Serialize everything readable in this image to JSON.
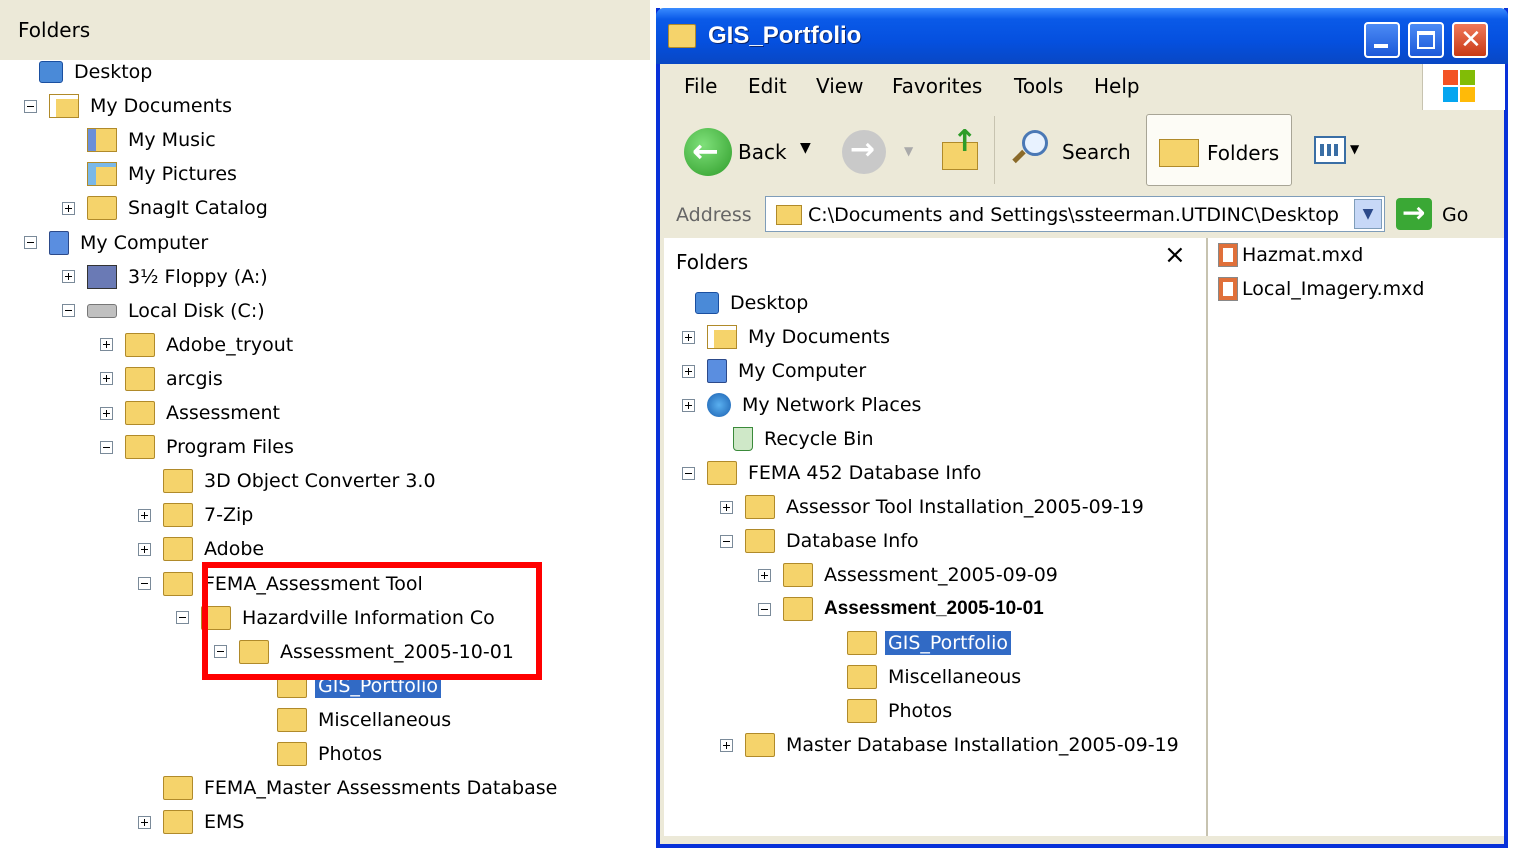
{
  "left_tree": {
    "header": "Folders",
    "items": [
      {
        "label": "Desktop",
        "icon": "desktop-icon",
        "exp": ""
      },
      {
        "label": "My Documents",
        "icon": "documents-icon",
        "exp": "minus"
      },
      {
        "label": "My Music",
        "icon": "music-folder-icon",
        "exp": ""
      },
      {
        "label": "My Pictures",
        "icon": "pictures-folder-icon",
        "exp": ""
      },
      {
        "label": "SnagIt Catalog",
        "icon": "folder-icon",
        "exp": "plus"
      },
      {
        "label": "My Computer",
        "icon": "computer-icon",
        "exp": "minus"
      },
      {
        "label": "3½ Floppy (A:)",
        "icon": "floppy-icon",
        "exp": "plus"
      },
      {
        "label": "Local Disk (C:)",
        "icon": "disk-icon",
        "exp": "minus"
      },
      {
        "label": "Adobe_tryout",
        "icon": "folder-icon",
        "exp": "plus"
      },
      {
        "label": "arcgis",
        "icon": "folder-icon",
        "exp": "plus"
      },
      {
        "label": "Assessment",
        "icon": "folder-icon",
        "exp": "plus"
      },
      {
        "label": "Program Files",
        "icon": "folder-icon",
        "exp": "minus"
      },
      {
        "label": "3D Object Converter 3.0",
        "icon": "folder-icon",
        "exp": ""
      },
      {
        "label": "7-Zip",
        "icon": "folder-icon",
        "exp": "plus"
      },
      {
        "label": "Adobe",
        "icon": "folder-icon",
        "exp": "plus"
      },
      {
        "label": "FEMA_Assessment Tool",
        "icon": "folder-icon",
        "exp": "minus"
      },
      {
        "label": "Hazardville Information Co",
        "icon": "folder-icon",
        "exp": "minus"
      },
      {
        "label": "Assessment_2005-10-01",
        "icon": "folder-icon",
        "exp": "minus"
      },
      {
        "label": "GIS_Portfolio",
        "icon": "folder-icon",
        "exp": "",
        "selected": true
      },
      {
        "label": "Miscellaneous",
        "icon": "folder-icon",
        "exp": ""
      },
      {
        "label": "Photos",
        "icon": "folder-icon",
        "exp": ""
      },
      {
        "label": "FEMA_Master Assessments Database",
        "icon": "folder-icon",
        "exp": ""
      },
      {
        "label": "EMS",
        "icon": "folder-icon",
        "exp": "plus"
      }
    ]
  },
  "window": {
    "title": "GIS_Portfolio",
    "menu": [
      "File",
      "Edit",
      "View",
      "Favorites",
      "Tools",
      "Help"
    ],
    "toolbar": {
      "back": "Back",
      "search": "Search",
      "folders": "Folders"
    },
    "address_label": "Address",
    "address_value": "C:\\Documents and Settings\\ssteerman.UTDINC\\Desktop",
    "go_label": "Go",
    "folders_pane": {
      "header": "Folders",
      "close_glyph": "×",
      "items": [
        {
          "label": "Desktop",
          "icon": "desktop-icon",
          "exp": ""
        },
        {
          "label": "My Documents",
          "icon": "documents-icon",
          "exp": "plus"
        },
        {
          "label": "My Computer",
          "icon": "computer-icon",
          "exp": "plus"
        },
        {
          "label": "My Network Places",
          "icon": "network-icon",
          "exp": "plus"
        },
        {
          "label": "Recycle Bin",
          "icon": "recycle-bin-icon",
          "exp": ""
        },
        {
          "label": "FEMA 452 Database Info",
          "icon": "folder-icon",
          "exp": "minus"
        },
        {
          "label": "Assessor Tool Installation_2005-09-19",
          "icon": "folder-icon",
          "exp": "plus"
        },
        {
          "label": "Database Info",
          "icon": "folder-icon",
          "exp": "minus"
        },
        {
          "label": "Assessment_2005-09-09",
          "icon": "folder-icon",
          "exp": "plus"
        },
        {
          "label": "Assessment_2005-10-01",
          "icon": "folder-icon",
          "exp": "minus",
          "bold": true
        },
        {
          "label": "GIS_Portfolio",
          "icon": "folder-icon",
          "exp": "",
          "selected": true
        },
        {
          "label": "Miscellaneous",
          "icon": "folder-icon",
          "exp": ""
        },
        {
          "label": "Photos",
          "icon": "folder-icon",
          "exp": ""
        },
        {
          "label": "Master Database Installation_2005-09-19",
          "icon": "folder-icon",
          "exp": "plus"
        }
      ]
    },
    "files": [
      {
        "label": "Hazmat.mxd",
        "icon": "mxd-file-icon"
      },
      {
        "label": "Local_Imagery.mxd",
        "icon": "mxd-file-icon"
      }
    ]
  },
  "colors": {
    "selection": "#316ac5",
    "title_bar": "#0a5ae8",
    "highlight_box": "#ff0000",
    "folder": "#f5d36b"
  }
}
